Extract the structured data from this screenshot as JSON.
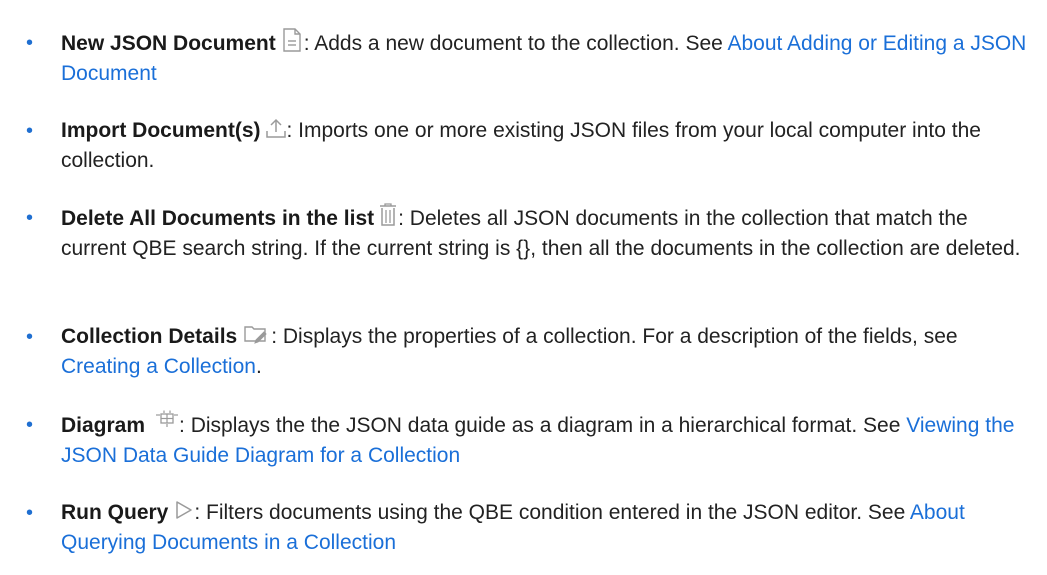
{
  "items": [
    {
      "label": "New JSON Document",
      "icon": "new-document-icon",
      "desc": ": Adds a new document to the collection. See ",
      "link": "About Adding or Editing a JSON Document",
      "tail": ""
    },
    {
      "label": "Import Document(s)",
      "icon": "upload-icon",
      "desc": ": Imports one or more existing JSON files from your local computer into the collection.",
      "link": "",
      "tail": ""
    },
    {
      "label": "Delete All Documents in the list",
      "icon": "trash-icon",
      "desc": ": Deletes all JSON documents in the collection that match the current QBE search string. If the current string is {}, then all the documents in the collection are deleted.",
      "link": "",
      "tail": ""
    },
    {
      "label": "Collection Details",
      "icon": "folder-edit-icon",
      "desc": ": Displays the properties of a collection. For a description of the fields, see ",
      "link": "Creating a Collection",
      "tail": "."
    },
    {
      "label": "Diagram",
      "icon": "diagram-icon",
      "desc": ": Displays the the JSON data guide as a diagram in a hierarchical format. See ",
      "link": "Viewing the JSON Data Guide Diagram for a Collection",
      "tail": ""
    },
    {
      "label": "Run Query",
      "icon": "play-icon",
      "desc": ": Filters documents using the QBE condition entered in the JSON editor. See ",
      "link": "About Querying Documents in a Collection",
      "tail": ""
    }
  ],
  "bullet_char": "•",
  "colors": {
    "bullet": "#1f6fd1",
    "link": "#1a6fd8",
    "text": "#222222",
    "icon": "#9a9a9a"
  }
}
